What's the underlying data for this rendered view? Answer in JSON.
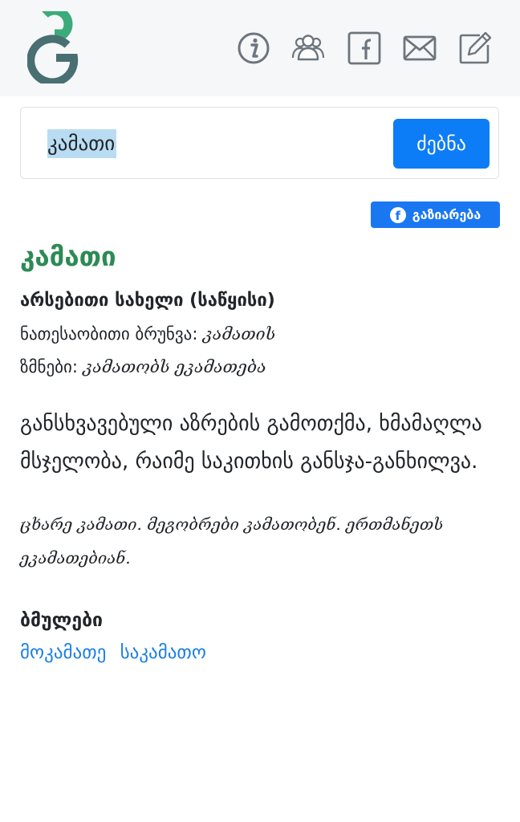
{
  "search": {
    "value": "კამათი",
    "button_label": "ძებნა"
  },
  "share": {
    "label": "გაზიარება"
  },
  "entry": {
    "headword": "კამათი",
    "part_of_speech": "არსებითი სახელი (საწყისი)",
    "genitive_label": "ნათესაობითი ბრუნვა:",
    "genitive_value": "კამათის",
    "verbs_label": "ზმნები:",
    "verbs_value": "კამათობს ეკამათება",
    "definition": "განსხვავებული აზრების გამოთქმა, ხმამაღლა მსჯელობა, რაიმე საკითხის განსჯა-განხილვა.",
    "example": "ცხარე კამათი. მეგობრები კამათობენ. ერთმანეთს ეკამათებიან."
  },
  "related": {
    "title": "ბმულები",
    "links": [
      "მოკამათე",
      "საკამათო"
    ]
  },
  "colors": {
    "header_bg": "#f6f7f9",
    "accent_green": "#2d8a55",
    "button_blue": "#0d7cf7",
    "facebook_blue": "#1a77f2",
    "link_blue": "#1a7fe6",
    "icon_gray": "#6c757d"
  },
  "icons": [
    "logo-icon",
    "info-icon",
    "users-icon",
    "facebook-icon",
    "mail-icon",
    "edit-icon"
  ]
}
